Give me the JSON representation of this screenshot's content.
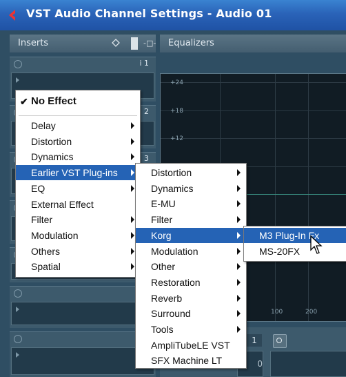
{
  "window": {
    "title": "VST Audio Channel Settings - Audio 01",
    "title_icon": "cubase-logo-icon"
  },
  "inserts": {
    "header_label": "Inserts",
    "header_icons": [
      "bypass-diamond-icon",
      "insert-toggle",
      "routing-icon"
    ],
    "slots": [
      {
        "number": "i 1"
      },
      {
        "number": "2"
      },
      {
        "number": "3"
      },
      {
        "number": ""
      },
      {
        "number": ""
      },
      {
        "number": ""
      },
      {
        "number": "1"
      }
    ]
  },
  "equalizers": {
    "header_label": "Equalizers",
    "y_ticks": [
      "+24",
      "+18",
      "+12"
    ],
    "x_ticks": [
      "100",
      "200"
    ],
    "band_number": "1",
    "band_value": "0"
  },
  "menu_effects": {
    "no_effect": "No Effect",
    "checkmark": "✔",
    "items": [
      {
        "label": "Delay",
        "submenu": true,
        "selected": false
      },
      {
        "label": "Distortion",
        "submenu": true,
        "selected": false
      },
      {
        "label": "Dynamics",
        "submenu": true,
        "selected": false
      },
      {
        "label": "Earlier VST Plug-ins",
        "submenu": true,
        "selected": true
      },
      {
        "label": "EQ",
        "submenu": true,
        "selected": false
      },
      {
        "label": "External Effect",
        "submenu": false,
        "selected": false
      },
      {
        "label": "Filter",
        "submenu": true,
        "selected": false
      },
      {
        "label": "Modulation",
        "submenu": true,
        "selected": false
      },
      {
        "label": "Others",
        "submenu": true,
        "selected": false
      },
      {
        "label": "Spatial",
        "submenu": true,
        "selected": false
      }
    ]
  },
  "menu_earlier": {
    "items": [
      {
        "label": "Distortion",
        "submenu": true,
        "selected": false
      },
      {
        "label": "Dynamics",
        "submenu": true,
        "selected": false
      },
      {
        "label": "E-MU",
        "submenu": true,
        "selected": false
      },
      {
        "label": "Filter",
        "submenu": true,
        "selected": false
      },
      {
        "label": "Korg",
        "submenu": true,
        "selected": true
      },
      {
        "label": "Modulation",
        "submenu": true,
        "selected": false
      },
      {
        "label": "Other",
        "submenu": true,
        "selected": false
      },
      {
        "label": "Restoration",
        "submenu": true,
        "selected": false
      },
      {
        "label": "Reverb",
        "submenu": true,
        "selected": false
      },
      {
        "label": "Surround",
        "submenu": true,
        "selected": false
      },
      {
        "label": "Tools",
        "submenu": true,
        "selected": false
      },
      {
        "label": "AmpliTubeLE VST",
        "submenu": false,
        "selected": false
      },
      {
        "label": "SFX Machine LT",
        "submenu": false,
        "selected": false
      }
    ]
  },
  "menu_korg": {
    "items": [
      {
        "label": "M3 Plug-In Fx",
        "submenu": false,
        "selected": true
      },
      {
        "label": "MS-20FX",
        "submenu": false,
        "selected": false
      }
    ]
  },
  "colors": {
    "titlebar": "#2a63b8",
    "selection": "#2563b5",
    "panel": "#3d5a6c"
  }
}
